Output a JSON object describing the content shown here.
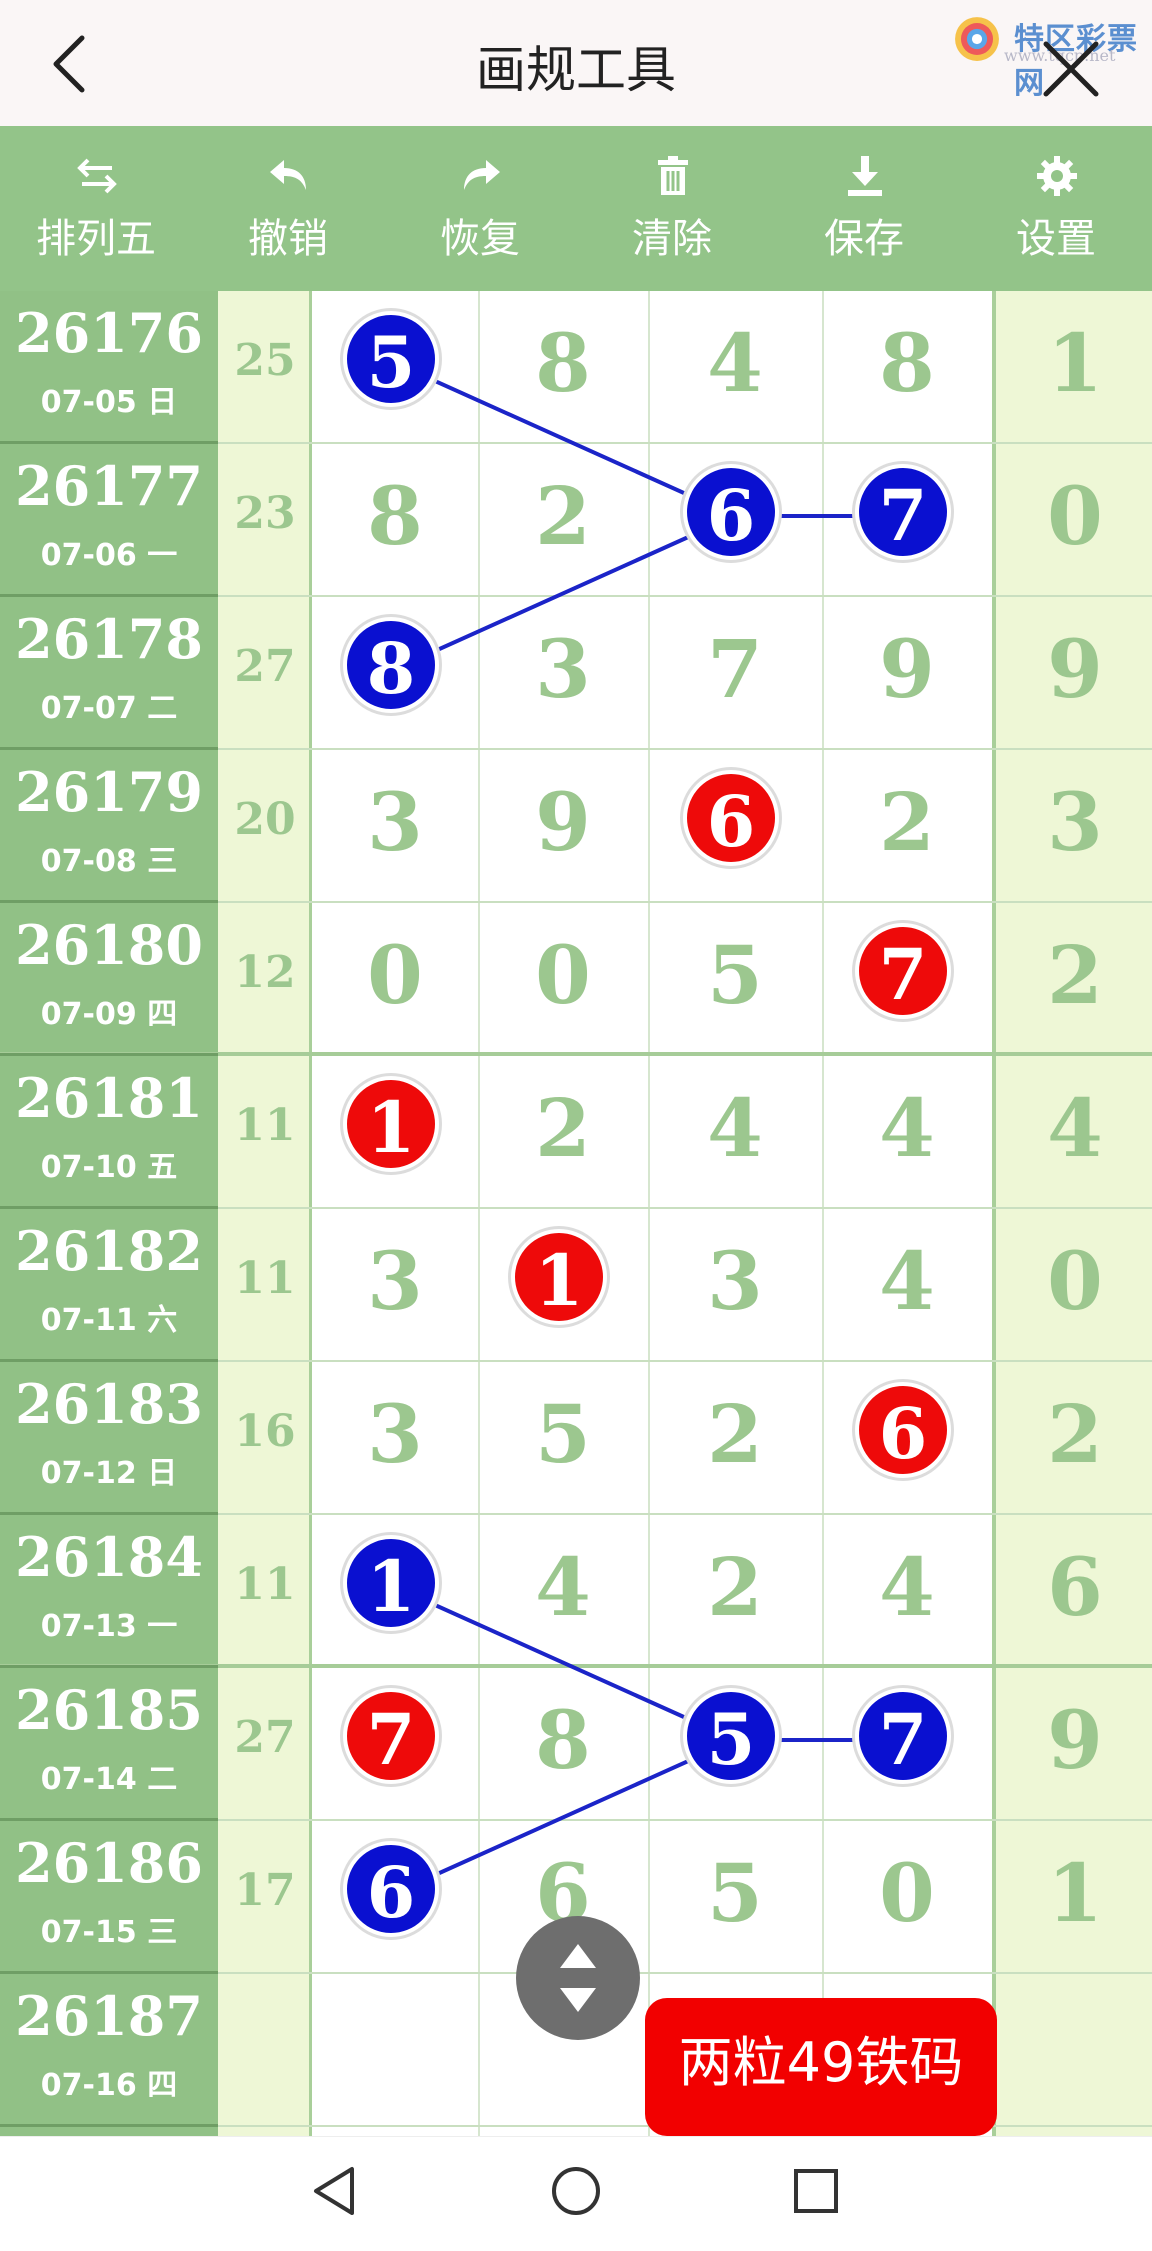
{
  "header": {
    "title": "画规工具",
    "logo_text": "特区彩票网",
    "logo_url": "www.tqcp.net"
  },
  "toolbar": [
    {
      "label": "排列五",
      "icon": "swap-icon"
    },
    {
      "label": "撤销",
      "icon": "undo-icon"
    },
    {
      "label": "恢复",
      "icon": "redo-icon"
    },
    {
      "label": "清除",
      "icon": "trash-icon"
    },
    {
      "label": "保存",
      "icon": "download-icon"
    },
    {
      "label": "设置",
      "icon": "gear-icon"
    }
  ],
  "rows": [
    {
      "period": "26176",
      "date": "07-05 日",
      "sum": "25",
      "d": [
        "5",
        "8",
        "4",
        "8"
      ],
      "tail": "1"
    },
    {
      "period": "26177",
      "date": "07-06 一",
      "sum": "23",
      "d": [
        "8",
        "2",
        "6",
        "7"
      ],
      "tail": "0"
    },
    {
      "period": "26178",
      "date": "07-07 二",
      "sum": "27",
      "d": [
        "8",
        "3",
        "7",
        "9"
      ],
      "tail": "9"
    },
    {
      "period": "26179",
      "date": "07-08 三",
      "sum": "20",
      "d": [
        "3",
        "9",
        "6",
        "2"
      ],
      "tail": "3"
    },
    {
      "period": "26180",
      "date": "07-09 四",
      "sum": "12",
      "d": [
        "0",
        "0",
        "5",
        "7"
      ],
      "tail": "2"
    },
    {
      "period": "26181",
      "date": "07-10 五",
      "sum": "11",
      "d": [
        "1",
        "2",
        "4",
        "4"
      ],
      "tail": "4"
    },
    {
      "period": "26182",
      "date": "07-11 六",
      "sum": "11",
      "d": [
        "3",
        "1",
        "3",
        "4"
      ],
      "tail": "0"
    },
    {
      "period": "26183",
      "date": "07-12 日",
      "sum": "16",
      "d": [
        "3",
        "5",
        "2",
        "6"
      ],
      "tail": "2"
    },
    {
      "period": "26184",
      "date": "07-13 一",
      "sum": "11",
      "d": [
        "1",
        "4",
        "2",
        "4"
      ],
      "tail": "6"
    },
    {
      "period": "26185",
      "date": "07-14 二",
      "sum": "27",
      "d": [
        "7",
        "8",
        "5",
        "7"
      ],
      "tail": "9"
    },
    {
      "period": "26186",
      "date": "07-15 三",
      "sum": "17",
      "d": [
        "6",
        "6",
        "5",
        "0"
      ],
      "tail": "1"
    },
    {
      "period": "26187",
      "date": "07-16 四",
      "sum": "",
      "d": [
        "",
        "",
        "",
        ""
      ],
      "tail": ""
    }
  ],
  "highlights": [
    {
      "row": 0,
      "col": 0,
      "color": "blue"
    },
    {
      "row": 1,
      "col": 2,
      "color": "blue"
    },
    {
      "row": 1,
      "col": 3,
      "color": "blue"
    },
    {
      "row": 2,
      "col": 0,
      "color": "blue"
    },
    {
      "row": 3,
      "col": 2,
      "color": "red"
    },
    {
      "row": 4,
      "col": 3,
      "color": "red"
    },
    {
      "row": 5,
      "col": 0,
      "color": "red"
    },
    {
      "row": 6,
      "col": 1,
      "color": "red"
    },
    {
      "row": 7,
      "col": 3,
      "color": "red"
    },
    {
      "row": 8,
      "col": 0,
      "color": "blue"
    },
    {
      "row": 9,
      "col": 0,
      "color": "red"
    },
    {
      "row": 9,
      "col": 2,
      "color": "blue"
    },
    {
      "row": 9,
      "col": 3,
      "color": "blue"
    },
    {
      "row": 10,
      "col": 0,
      "color": "blue"
    }
  ],
  "connectors": [
    {
      "from": [
        0,
        0
      ],
      "to": [
        1,
        2
      ]
    },
    {
      "from": [
        1,
        2
      ],
      "to": [
        1,
        3
      ]
    },
    {
      "from": [
        2,
        0
      ],
      "to": [
        1,
        2
      ]
    },
    {
      "from": [
        8,
        0
      ],
      "to": [
        9,
        2
      ]
    },
    {
      "from": [
        9,
        2
      ],
      "to": [
        9,
        3
      ]
    },
    {
      "from": [
        10,
        0
      ],
      "to": [
        9,
        2
      ]
    }
  ],
  "colors": {
    "toolbar": "#93c489",
    "period_col": "#91c186",
    "digit": "#9cc78f",
    "ball_blue": "#0a10d0",
    "ball_red": "#ee0a0a",
    "line": "#1b24c8"
  },
  "promo": {
    "label": "两粒49铁码"
  },
  "scroll_button": {
    "icon": "scroll-updown-icon"
  },
  "navbar": {
    "icons": [
      "back-triangle-icon",
      "home-circle-icon",
      "recents-square-icon"
    ]
  }
}
